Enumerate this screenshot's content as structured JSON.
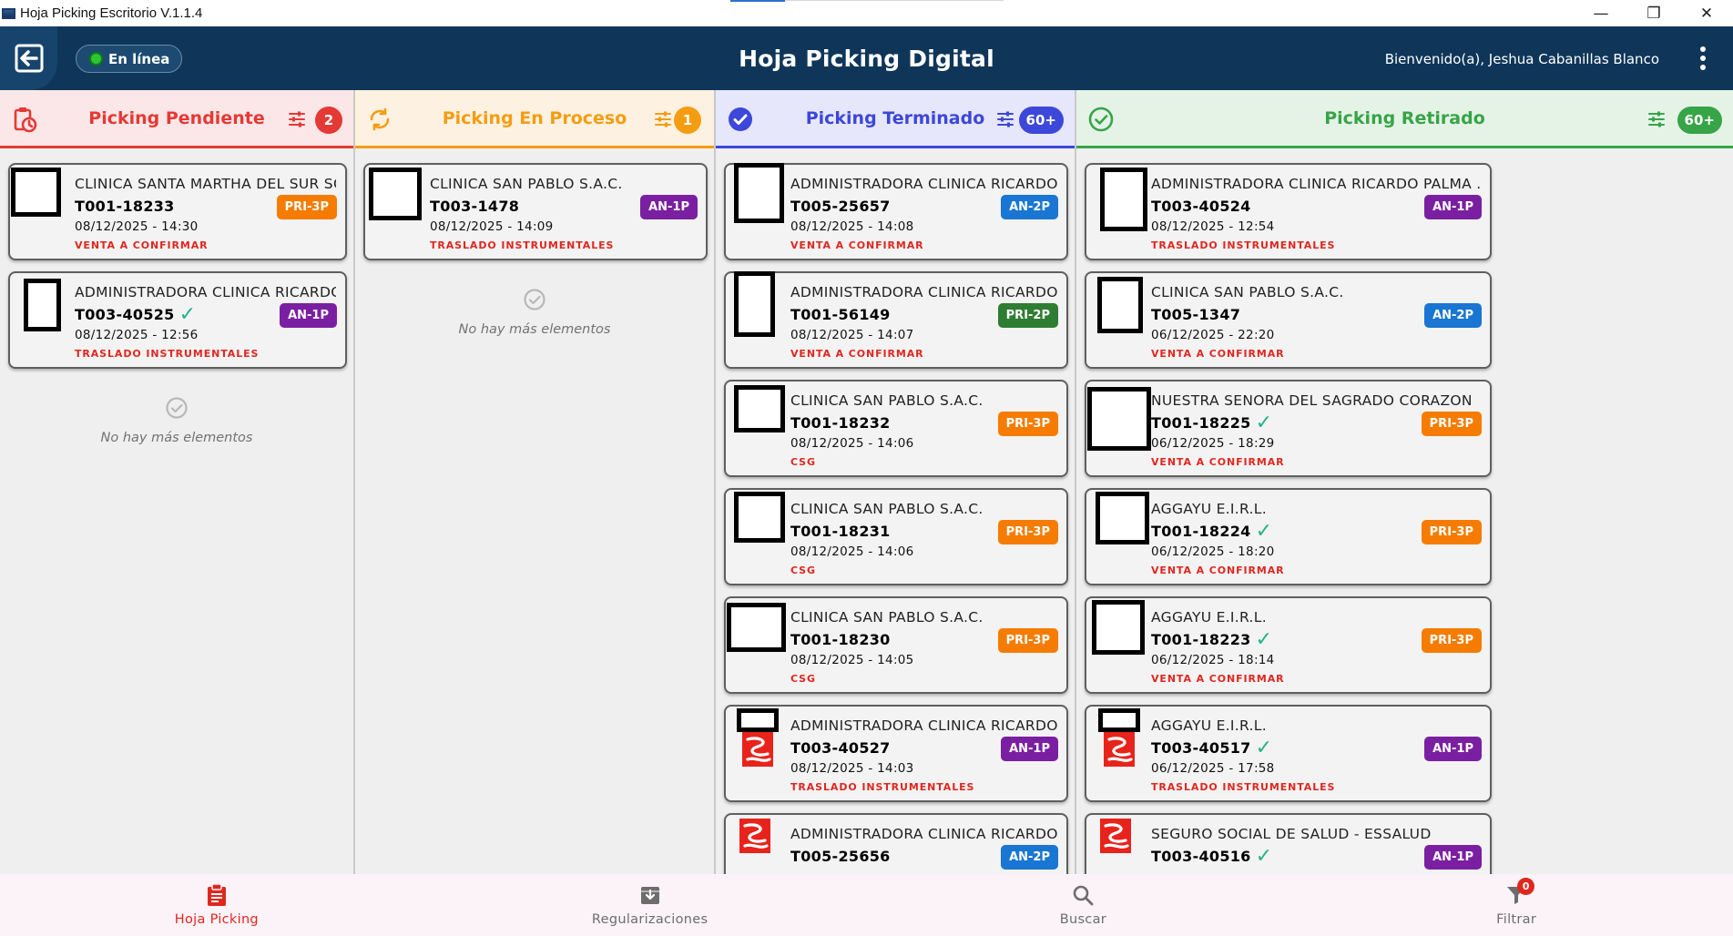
{
  "window": {
    "title": "Hoja Picking Escritorio V.1.1.4",
    "minimize_glyph": "—",
    "maximize_glyph": "❐",
    "close_glyph": "✕"
  },
  "header": {
    "title": "Hoja Picking Digital",
    "status": "En línea",
    "welcome": "Bienvenido(a), Jeshua Cabanillas Blanco",
    "back_icon": "exit-arrow-icon",
    "menu_icon": "more-vert-icon"
  },
  "colors": {
    "pendiente": "#e53935",
    "proceso": "#f49d12",
    "terminado": "#3d47d9",
    "retirado": "#37a447",
    "tag_orange": "#f57c00",
    "tag_purple": "#7b1fa2",
    "tag_blue": "#1976d2",
    "tag_green": "#2e7d32",
    "status_red": "#e0271f"
  },
  "columns": [
    {
      "title": "Picking Pendiente",
      "count": "2",
      "icon": "clipboard-clock-icon",
      "cards": [
        {
          "client": "CLINICA SANTA MARTHA DEL SUR SOCIEDAD ...",
          "code": "T001-18233",
          "verified": false,
          "date": "08/12/2025 - 14:30",
          "status": "VENTA A CONFIRMAR",
          "tag": "PRI-3P",
          "tag_color": "orange"
        },
        {
          "client": "ADMINISTRADORA CLINICA RICARDO PALMA ...",
          "code": "T003-40525",
          "verified": true,
          "date": "08/12/2025 - 12:56",
          "status": "TRASLADO INSTRUMENTALES",
          "tag": "AN-1P",
          "tag_color": "purple"
        }
      ],
      "empty_text": "No hay más elementos"
    },
    {
      "title": "Picking En Proceso",
      "count": "1",
      "icon": "sync-icon",
      "cards": [
        {
          "client": "CLINICA SAN PABLO S.A.C.",
          "code": "T003-1478",
          "verified": false,
          "date": "08/12/2025 - 14:09",
          "status": "TRASLADO INSTRUMENTALES",
          "tag": "AN-1P",
          "tag_color": "purple"
        }
      ],
      "empty_text": "No hay más elementos"
    },
    {
      "title": "Picking Terminado",
      "count": "60+",
      "icon": "check-circle-filled-icon",
      "cards": [
        {
          "client": "ADMINISTRADORA CLINICA RICARDO PALMA ...",
          "code": "T005-25657",
          "verified": false,
          "date": "08/12/2025 - 14:08",
          "status": "VENTA A CONFIRMAR",
          "tag": "AN-2P",
          "tag_color": "blue"
        },
        {
          "client": "ADMINISTRADORA CLINICA RICARDO PALMA ...",
          "code": "T001-56149",
          "verified": false,
          "date": "08/12/2025 - 14:07",
          "status": "VENTA A CONFIRMAR",
          "tag": "PRI-2P",
          "tag_color": "green"
        },
        {
          "client": "CLINICA SAN PABLO S.A.C.",
          "code": "T001-18232",
          "verified": false,
          "date": "08/12/2025 - 14:06",
          "status": "CSG",
          "tag": "PRI-3P",
          "tag_color": "orange"
        },
        {
          "client": "CLINICA SAN PABLO S.A.C.",
          "code": "T001-18231",
          "verified": false,
          "date": "08/12/2025 - 14:06",
          "status": "CSG",
          "tag": "PRI-3P",
          "tag_color": "orange"
        },
        {
          "client": "CLINICA SAN PABLO S.A.C.",
          "code": "T001-18230",
          "verified": false,
          "date": "08/12/2025 - 14:05",
          "status": "CSG",
          "tag": "PRI-3P",
          "tag_color": "orange"
        },
        {
          "client": "ADMINISTRADORA CLINICA RICARDO PALMA ...",
          "code": "T003-40527",
          "verified": false,
          "date": "08/12/2025 - 14:03",
          "status": "TRASLADO INSTRUMENTALES",
          "tag": "AN-1P",
          "tag_color": "purple"
        },
        {
          "client": "ADMINISTRADORA CLINICA RICARDO PALMA ...",
          "code": "T005-25656",
          "verified": false,
          "date": "",
          "status": "",
          "tag": "AN-2P",
          "tag_color": "blue"
        }
      ]
    },
    {
      "title": "Picking Retirado",
      "count": "60+",
      "icon": "check-circle-outline-icon",
      "cards": [
        {
          "client": "ADMINISTRADORA CLINICA RICARDO PALMA ...",
          "code": "T003-40524",
          "verified": false,
          "date": "08/12/2025 - 12:54",
          "status": "TRASLADO INSTRUMENTALES",
          "tag": "AN-1P",
          "tag_color": "purple"
        },
        {
          "client": "CLINICA SAN PABLO S.A.C.",
          "code": "T005-1347",
          "verified": false,
          "date": "06/12/2025 - 22:20",
          "status": "VENTA A CONFIRMAR",
          "tag": "AN-2P",
          "tag_color": "blue"
        },
        {
          "client": "NUESTRA SENORA DEL SAGRADO CORAZON",
          "code": "T001-18225",
          "verified": true,
          "date": "06/12/2025 - 18:29",
          "status": "VENTA A CONFIRMAR",
          "tag": "PRI-3P",
          "tag_color": "orange"
        },
        {
          "client": "AGGAYU E.I.R.L.",
          "code": "T001-18224",
          "verified": true,
          "date": "06/12/2025 - 18:20",
          "status": "VENTA A CONFIRMAR",
          "tag": "PRI-3P",
          "tag_color": "orange"
        },
        {
          "client": "AGGAYU E.I.R.L.",
          "code": "T001-18223",
          "verified": true,
          "date": "06/12/2025 - 18:14",
          "status": "VENTA A CONFIRMAR",
          "tag": "PRI-3P",
          "tag_color": "orange"
        },
        {
          "client": "AGGAYU E.I.R.L.",
          "code": "T003-40517",
          "verified": true,
          "date": "06/12/2025 - 17:58",
          "status": "TRASLADO INSTRUMENTALES",
          "tag": "AN-1P",
          "tag_color": "purple"
        },
        {
          "client": "SEGURO SOCIAL DE SALUD - ESSALUD",
          "code": "T003-40516",
          "verified": true,
          "date": "",
          "status": "",
          "tag": "AN-1P",
          "tag_color": "purple"
        }
      ]
    }
  ],
  "bottom_nav": [
    {
      "label": "Hoja Picking",
      "icon": "clipboard-list-icon",
      "active": true
    },
    {
      "label": "Regularizaciones",
      "icon": "archive-download-icon",
      "active": false
    },
    {
      "label": "Buscar",
      "icon": "search-icon",
      "active": false
    },
    {
      "label": "Filtrar",
      "icon": "filter-icon",
      "active": false,
      "badge": "0"
    }
  ]
}
